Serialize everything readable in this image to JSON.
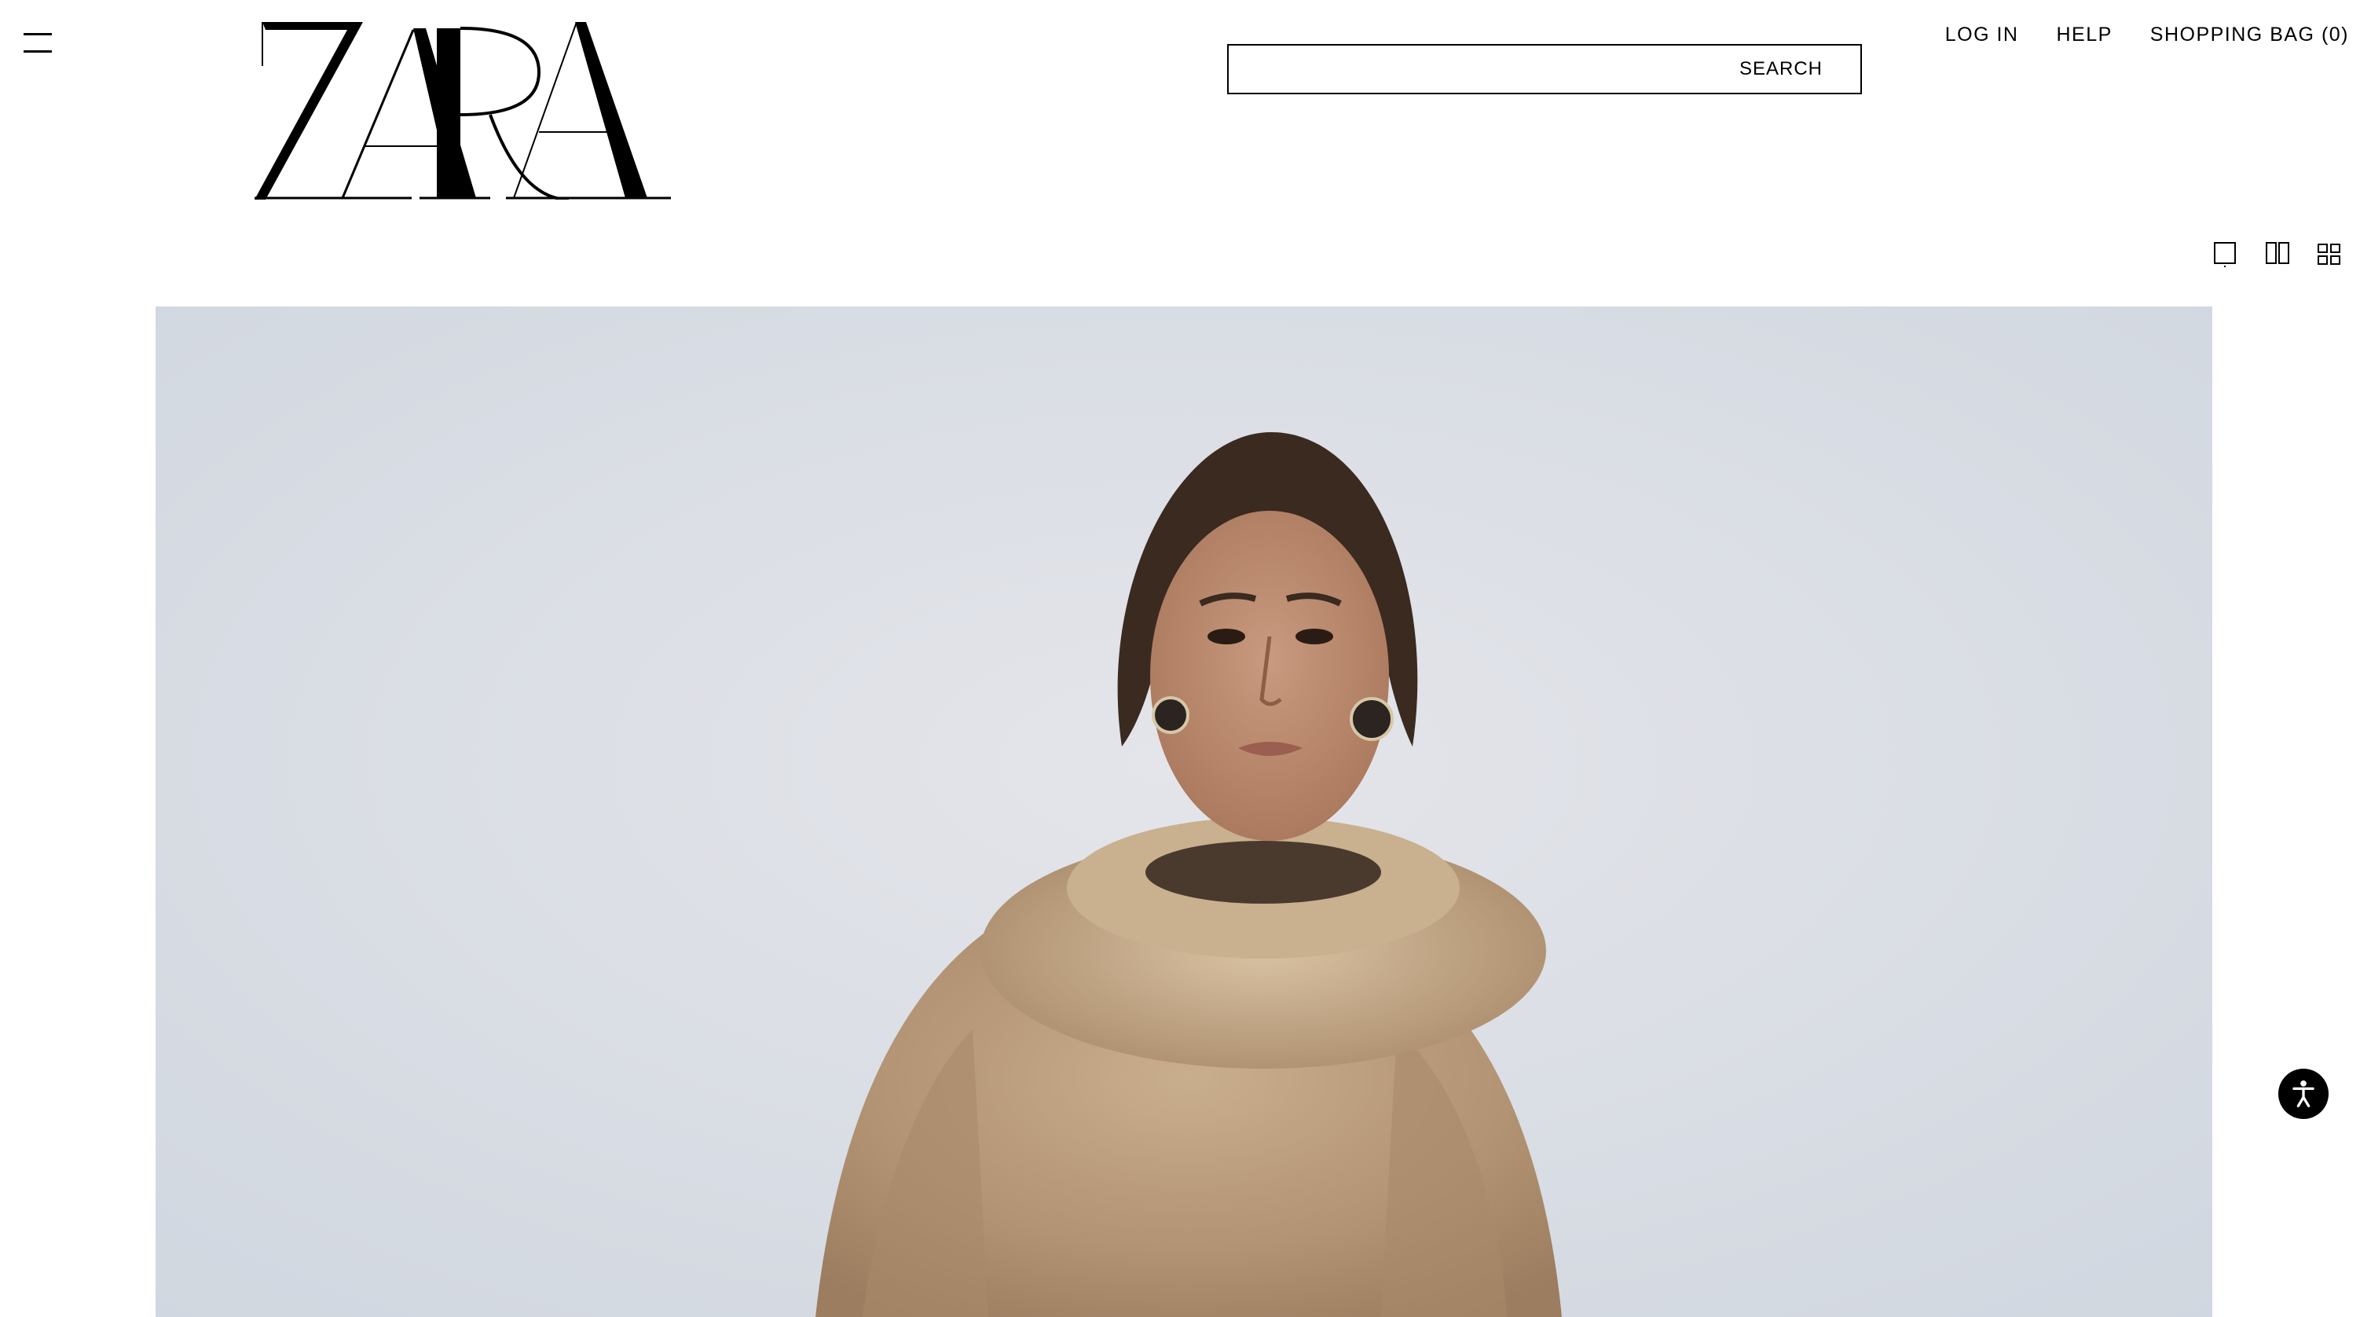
{
  "header": {
    "brand": "ZARA",
    "search": {
      "label": "SEARCH",
      "value": ""
    },
    "nav": {
      "login": "LOG IN",
      "help": "HELP",
      "shopping_bag": "SHOPPING BAG (0)"
    }
  },
  "view_options": [
    "single-column-view",
    "two-column-view",
    "grid-view"
  ],
  "hero": {
    "image": "model wearing beige faux fur high-neck jacket against pale grey-blue backdrop"
  },
  "icons": {
    "menu": "hamburger-icon",
    "accessibility": "accessibility-icon"
  },
  "colors": {
    "text": "#000000",
    "background": "#ffffff",
    "backdrop": "#d9dde3",
    "fur": "#b89a78"
  }
}
